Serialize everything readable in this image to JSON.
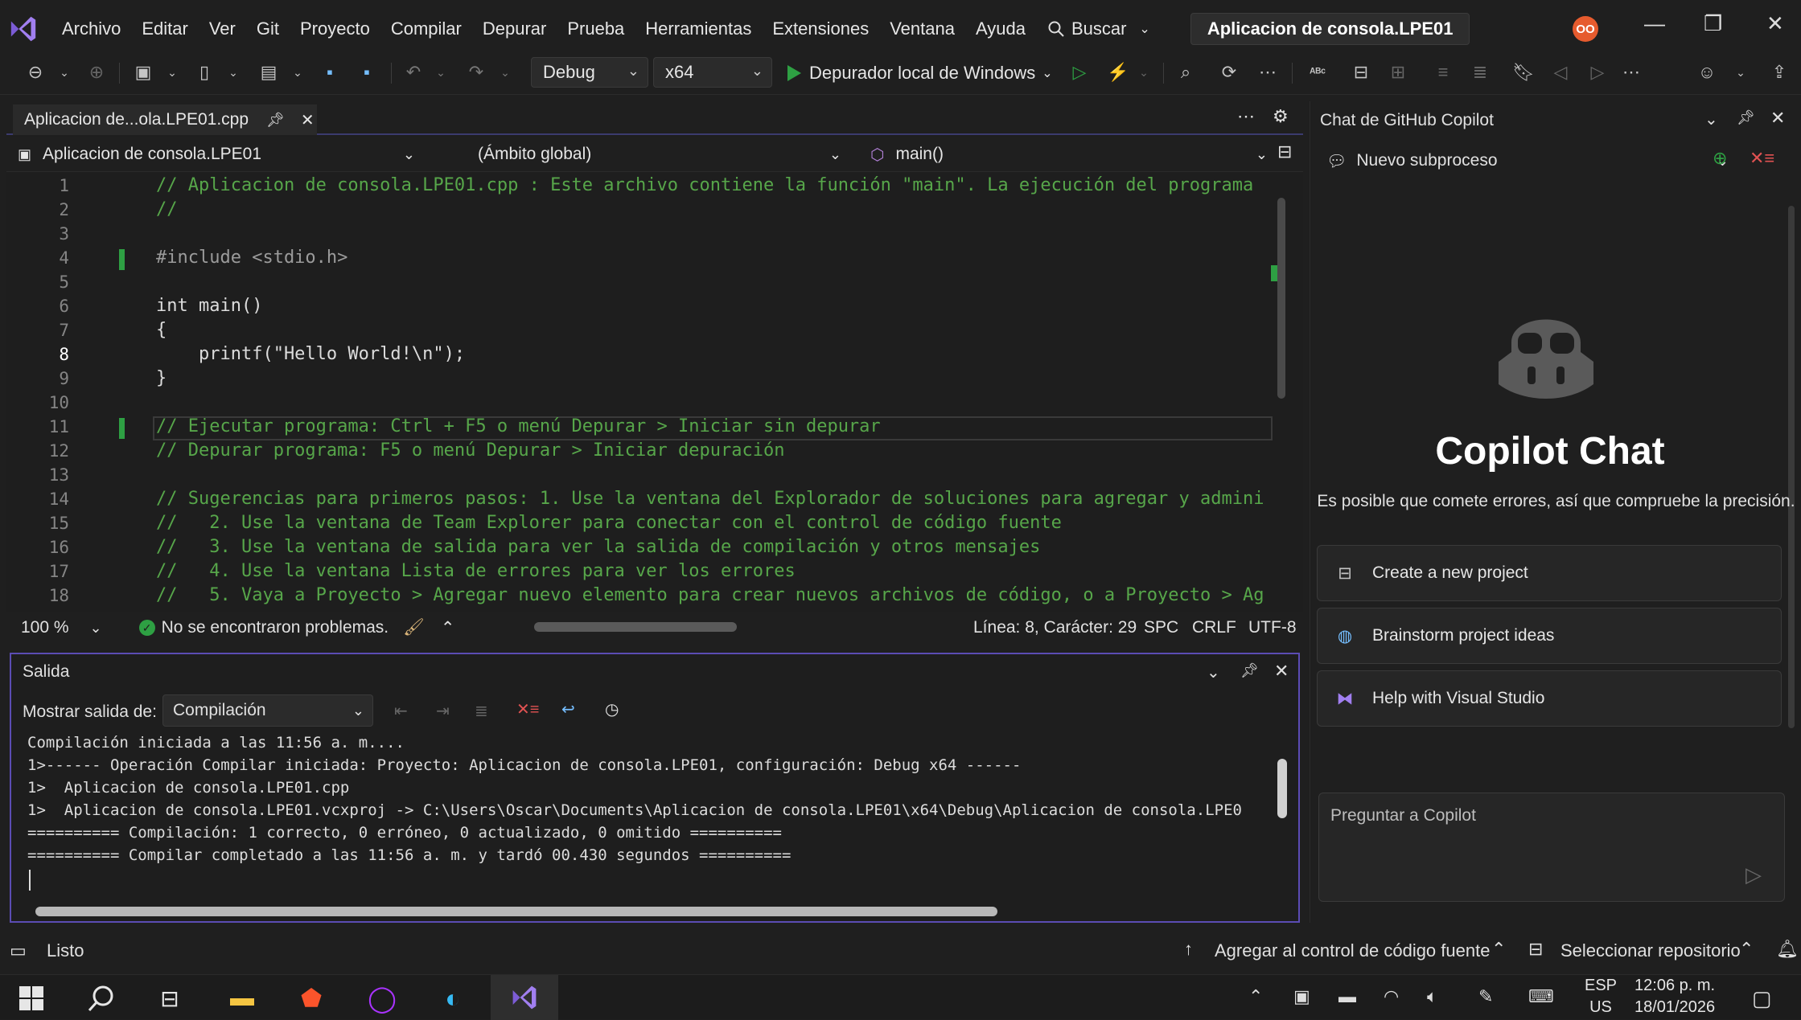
{
  "menubar": {
    "items": [
      "Archivo",
      "Editar",
      "Ver",
      "Git",
      "Proyecto",
      "Compilar",
      "Depurar",
      "Prueba",
      "Herramientas",
      "Extensiones",
      "Ventana",
      "Ayuda"
    ],
    "search_label": "Buscar",
    "window_title": "Aplicacion de consola.LPE01",
    "avatar_initials": "OO"
  },
  "toolbar": {
    "config": "Debug",
    "platform": "x64",
    "run_label": "Depurador local de Windows"
  },
  "editor": {
    "tab_label": "Aplicacion de...ola.LPE01.cpp",
    "nav_project": "Aplicacion de consola.LPE01",
    "nav_scope": "(Ámbito global)",
    "nav_function": "main()",
    "lines": [
      "// Aplicacion de consola.LPE01.cpp : Este archivo contiene la función \"main\". La ejecución del programa",
      "//",
      "",
      "#include <stdio.h>",
      "",
      "int main()",
      "{",
      "    printf(\"Hello World!\\n\");",
      "}",
      "",
      "// Ejecutar programa: Ctrl + F5 o menú Depurar > Iniciar sin depurar",
      "// Depurar programa: F5 o menú Depurar > Iniciar depuración",
      "",
      "// Sugerencias para primeros pasos: 1. Use la ventana del Explorador de soluciones para agregar y admini",
      "//   2. Use la ventana de Team Explorer para conectar con el control de código fuente",
      "//   3. Use la ventana de salida para ver la salida de compilación y otros mensajes",
      "//   4. Use la ventana Lista de errores para ver los errores",
      "//   5. Vaya a Proyecto > Agregar nuevo elemento para crear nuevos archivos de código, o a Proyecto > Ag"
    ],
    "line_numbers": [
      "1",
      "2",
      "3",
      "4",
      "5",
      "6",
      "7",
      "8",
      "9",
      "10",
      "11",
      "12",
      "13",
      "14",
      "15",
      "16",
      "17",
      "18"
    ],
    "zoom": "100 %",
    "problems": "No se encontraron problemas.",
    "position": "Línea: 8, Carácter: 29",
    "spc": "SPC",
    "crlf": "CRLF",
    "encoding": "UTF-8"
  },
  "output": {
    "title": "Salida",
    "show_from_label": "Mostrar salida de:",
    "source": "Compilación",
    "lines": [
      "Compilación iniciada a las 11:56 a. m....",
      "1>------ Operación Compilar iniciada: Proyecto: Aplicacion de consola.LPE01, configuración: Debug x64 ------",
      "1>  Aplicacion de consola.LPE01.cpp",
      "1>  Aplicacion de consola.LPE01.vcxproj -> C:\\Users\\Oscar\\Documents\\Aplicacion de consola.LPE01\\x64\\Debug\\Aplicacion de consola.LPE0",
      "========== Compilación: 1 correcto, 0 erróneo, 0 actualizado, 0 omitido ==========",
      "========== Compilar completado a las 11:56 a. m. y tardó 00.430 segundos =========="
    ]
  },
  "copilot": {
    "panel_title": "Chat de GitHub Copilot",
    "thread": "Nuevo subproceso",
    "heading": "Copilot Chat",
    "disclaimer": "Es posible que comete errores, así que compruebe la precisión.",
    "suggestions": [
      "Create a new project",
      "Brainstorm project ideas",
      "Help with Visual Studio"
    ],
    "ask_placeholder": "Preguntar a Copilot"
  },
  "statusbar": {
    "ready": "Listo",
    "source_control": "Agregar al control de código fuente",
    "repo": "Seleccionar repositorio"
  },
  "taskbar": {
    "lang": "ESP",
    "region": "US",
    "time": "12:06 p. m.",
    "date": "18/01/2026"
  },
  "colors": {
    "accent": "#5b4cb4",
    "comment": "#57a64a",
    "keyword": "#569cd6",
    "run_green": "#2ea043"
  }
}
